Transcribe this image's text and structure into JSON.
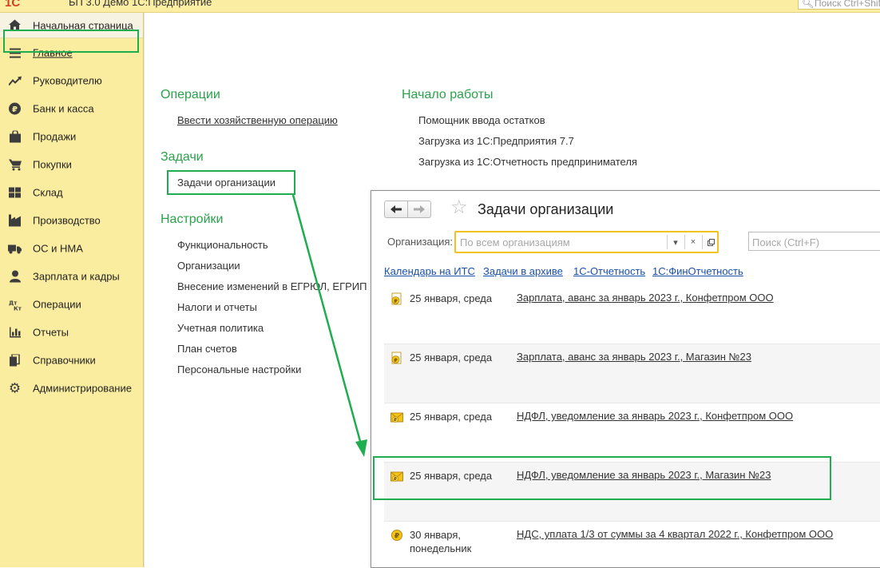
{
  "window": {
    "logo": "1С",
    "title": "БП 3.0 Демо 1С:Предприятие",
    "search_placeholder": "Поиск Ctrl+Shift+F"
  },
  "sidebar": {
    "home": {
      "label": "Начальная страница",
      "icon": "home-icon"
    },
    "items": [
      {
        "label": "Главное",
        "icon": "menu-lines-icon",
        "active": true
      },
      {
        "label": "Руководителю",
        "icon": "trend-icon"
      },
      {
        "label": "Банк и касса",
        "icon": "ruble-icon"
      },
      {
        "label": "Продажи",
        "icon": "shopping-bag-icon"
      },
      {
        "label": "Покупки",
        "icon": "cart-icon"
      },
      {
        "label": "Склад",
        "icon": "warehouse-icon"
      },
      {
        "label": "Производство",
        "icon": "factory-icon"
      },
      {
        "label": "ОС и НМА",
        "icon": "truck-icon"
      },
      {
        "label": "Зарплата и кадры",
        "icon": "person-icon"
      },
      {
        "label": "Операции",
        "icon": "debit-credit-icon"
      },
      {
        "label": "Отчеты",
        "icon": "bar-chart-icon"
      },
      {
        "label": "Справочники",
        "icon": "books-icon"
      },
      {
        "label": "Администрирование",
        "icon": "gear-icon"
      }
    ]
  },
  "main": {
    "operations": {
      "title": "Операции",
      "items": [
        "Ввести хозяйственную операцию"
      ]
    },
    "tasks": {
      "title": "Задачи",
      "items": [
        "Задачи организации"
      ]
    },
    "settings": {
      "title": "Настройки",
      "items": [
        "Функциональность",
        "Организации",
        "Внесение изменений в ЕГРЮЛ, ЕГРИП",
        "Налоги и отчеты",
        "Учетная политика",
        "План счетов",
        "Персональные настройки"
      ]
    },
    "start": {
      "title": "Начало работы",
      "items": [
        "Помощник ввода остатков",
        "Загрузка из 1С:Предприятия 7.7",
        "Загрузка из 1С:Отчетность предпринимателя"
      ]
    }
  },
  "tasks_window": {
    "title": "Задачи организации",
    "org_label": "Организация:",
    "org_placeholder": "По всем организациям",
    "search_placeholder": "Поиск (Ctrl+F)",
    "links": [
      "Календарь на ИТС",
      "Задачи в архиве",
      "1С-Отчетность",
      "1С:ФинОтчетность"
    ],
    "rows": [
      {
        "date": "25 января, среда",
        "text": "Зарплата, аванс за январь 2023 г., Конфетпром ООО",
        "icon": "document-ruble-icon"
      },
      {
        "date": "25 января, среда",
        "text": "Зарплата, аванс за январь 2023 г., Магазин №23",
        "icon": "document-ruble-icon"
      },
      {
        "date": "25 января, среда",
        "text": "НДФЛ, уведомление за январь 2023 г., Конфетпром ООО",
        "icon": "envelope-ruble-icon"
      },
      {
        "date": "25 января, среда",
        "text": "НДФЛ, уведомление за январь 2023 г., Магазин №23",
        "icon": "envelope-ruble-icon"
      },
      {
        "date": "30 января, понедельник",
        "text": "НДС, уплата 1/3 от суммы за 4 квартал 2022 г., Конфетпром ООО",
        "icon": "coin-ruble-icon"
      }
    ]
  },
  "colors": {
    "accent_green": "#1fad4f",
    "section_green": "#2aa24b",
    "sidebar_bg": "#fbed9f",
    "link_blue": "#1a50a8",
    "field_yellow": "#f2c21f"
  }
}
